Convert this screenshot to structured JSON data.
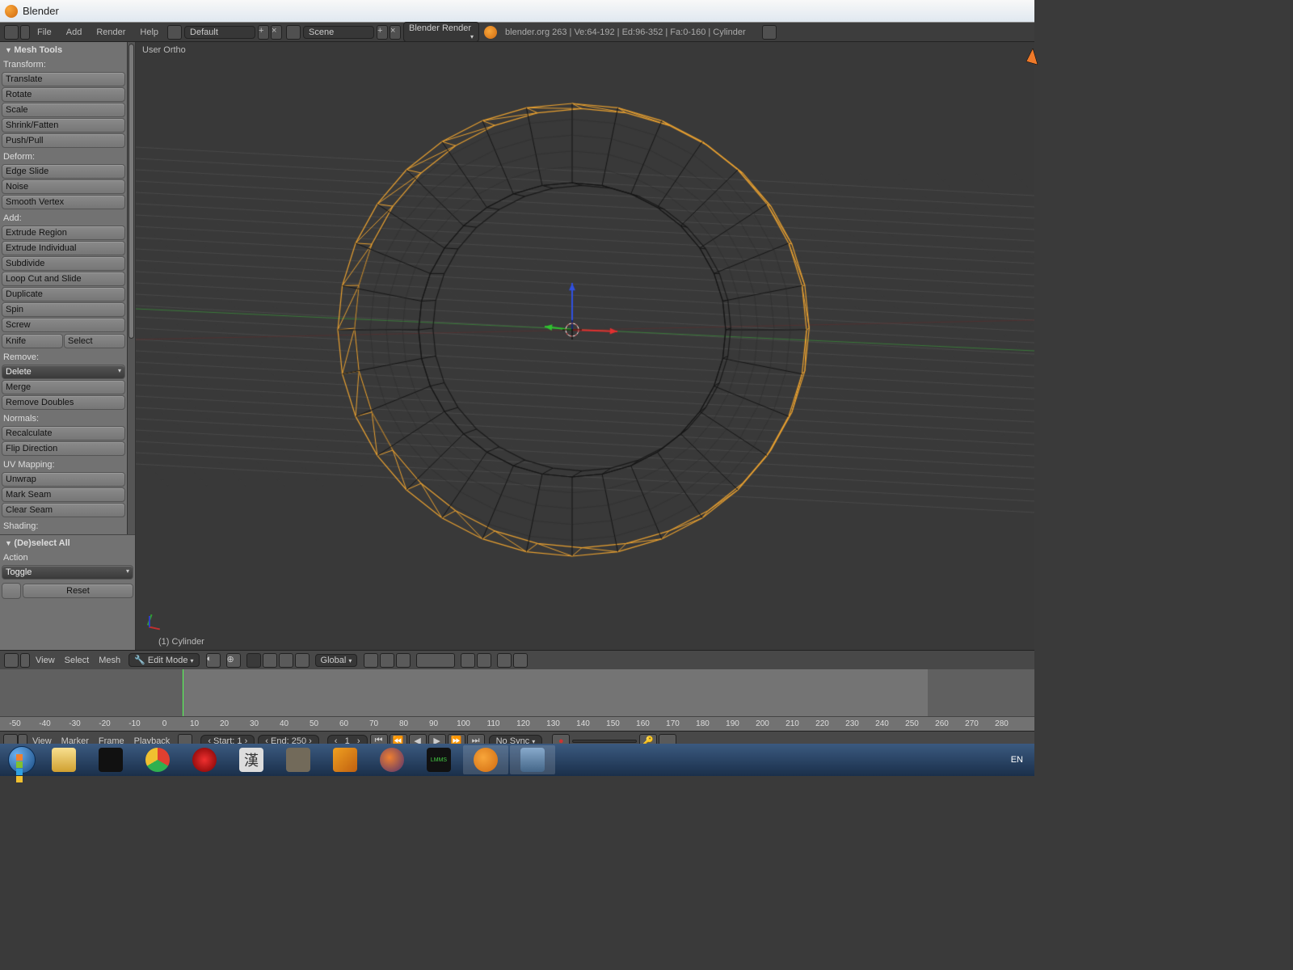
{
  "window": {
    "title": "Blender"
  },
  "toolbar": {
    "menus": [
      "File",
      "Add",
      "Render",
      "Help"
    ],
    "layout": "Default",
    "scene": "Scene",
    "engine": "Blender Render",
    "status": "blender.org 263 | Ve:64-192 | Ed:96-352 | Fa:0-160 | Cylinder"
  },
  "mesh_tools": {
    "title": "Mesh Tools",
    "transform_label": "Transform:",
    "transform": [
      "Translate",
      "Rotate",
      "Scale",
      "Shrink/Fatten",
      "Push/Pull"
    ],
    "deform_label": "Deform:",
    "deform": [
      "Edge Slide",
      "Noise",
      "Smooth Vertex"
    ],
    "add_label": "Add:",
    "add": [
      "Extrude Region",
      "Extrude Individual",
      "Subdivide",
      "Loop Cut and Slide",
      "Duplicate",
      "Spin",
      "Screw"
    ],
    "knife": "Knife",
    "select": "Select",
    "remove_label": "Remove:",
    "remove": [
      "Delete",
      "Merge",
      "Remove Doubles"
    ],
    "normals_label": "Normals:",
    "normals": [
      "Recalculate",
      "Flip Direction"
    ],
    "uv_label": "UV Mapping:",
    "uv": [
      "Unwrap",
      "Mark Seam",
      "Clear Seam"
    ],
    "shading_label": "Shading:"
  },
  "last_op": {
    "title": "(De)select All",
    "action_label": "Action",
    "action": "Toggle",
    "reset": "Reset"
  },
  "viewport": {
    "hint": "User Ortho",
    "object_name": "(1) Cylinder"
  },
  "vhdr": {
    "menus": [
      "View",
      "Select",
      "Mesh"
    ],
    "mode": "Edit Mode",
    "orientation": "Global"
  },
  "timeline": {
    "menus": [
      "View",
      "Marker",
      "Frame",
      "Playback"
    ],
    "start_label": "Start:",
    "start": "1",
    "end_label": "End:",
    "end": "250",
    "current_label": "",
    "current": "1",
    "sync": "No Sync",
    "ticks": [
      "-50",
      "-40",
      "-30",
      "-20",
      "-10",
      "0",
      "10",
      "20",
      "30",
      "40",
      "50",
      "60",
      "70",
      "80",
      "90",
      "100",
      "110",
      "120",
      "130",
      "140",
      "150",
      "160",
      "170",
      "180",
      "190",
      "200",
      "210",
      "220",
      "230",
      "240",
      "250",
      "260",
      "270",
      "280"
    ]
  },
  "taskbar": {
    "lang": "EN"
  }
}
